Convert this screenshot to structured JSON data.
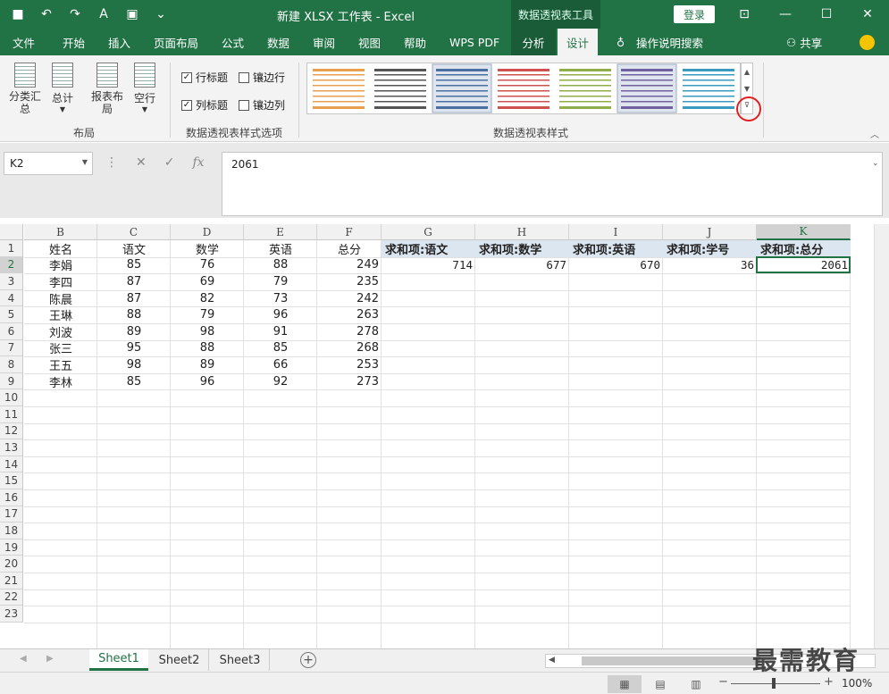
{
  "window": {
    "title": "新建 XLSX 工作表  -  Excel",
    "context_tool": "数据透视表工具",
    "login": "登录",
    "share": "共享",
    "help_search": "操作说明搜索"
  },
  "colors": {
    "excel_green": "#217346",
    "pivot_header": "#dce6f1",
    "highlight_circle": "#e02020"
  },
  "tabs": [
    "文件",
    "开始",
    "插入",
    "页面布局",
    "公式",
    "数据",
    "审阅",
    "视图",
    "帮助",
    "WPS PDF",
    "分析",
    "设计"
  ],
  "ribbon": {
    "layout_buttons": [
      "分类汇\n总",
      "总计",
      "报表布\n局",
      "空行"
    ],
    "layout_group": "布局",
    "options": [
      {
        "label": "行标题",
        "checked": true
      },
      {
        "label": "镶边行",
        "checked": false
      },
      {
        "label": "列标题",
        "checked": true
      },
      {
        "label": "镶边列",
        "checked": false
      }
    ],
    "options_group": "数据透视表样式选项",
    "styles_group": "数据透视表样式",
    "style_colors": [
      "#e8a050",
      "#555555",
      "#4a6fa0",
      "#d05050",
      "#8fae4a",
      "#7060a0",
      "#3a9ac0"
    ]
  },
  "formula_bar": {
    "name_box": "K2",
    "value": "2061",
    "fx": "fx"
  },
  "grid": {
    "columns": [
      "B",
      "C",
      "D",
      "E",
      "F",
      "G",
      "H",
      "I",
      "J",
      "K"
    ],
    "rows": [
      "1",
      "2",
      "3",
      "4",
      "5",
      "6",
      "7",
      "8",
      "9",
      "10",
      "11",
      "12",
      "13",
      "14",
      "15",
      "16",
      "17",
      "18",
      "19",
      "20",
      "21",
      "22",
      "23"
    ],
    "headers": [
      "姓名",
      "语文",
      "数学",
      "英语",
      "总分"
    ],
    "data": [
      [
        "李娟",
        "85",
        "76",
        "88",
        "249"
      ],
      [
        "李四",
        "87",
        "69",
        "79",
        "235"
      ],
      [
        "陈晨",
        "87",
        "82",
        "73",
        "242"
      ],
      [
        "王琳",
        "88",
        "79",
        "96",
        "263"
      ],
      [
        "刘波",
        "89",
        "98",
        "91",
        "278"
      ],
      [
        "张三",
        "95",
        "88",
        "85",
        "268"
      ],
      [
        "王五",
        "98",
        "89",
        "66",
        "253"
      ],
      [
        "李林",
        "85",
        "96",
        "92",
        "273"
      ]
    ],
    "pivot_headers": [
      "求和项:语文",
      "求和项:数学",
      "求和项:英语",
      "求和项:学号",
      "求和项:总分"
    ],
    "pivot_values": [
      "714",
      "677",
      "670",
      "36",
      "2061"
    ]
  },
  "sheets": [
    "Sheet1",
    "Sheet2",
    "Sheet3"
  ],
  "status": {
    "zoom": "100%"
  },
  "watermark": "最需教育"
}
